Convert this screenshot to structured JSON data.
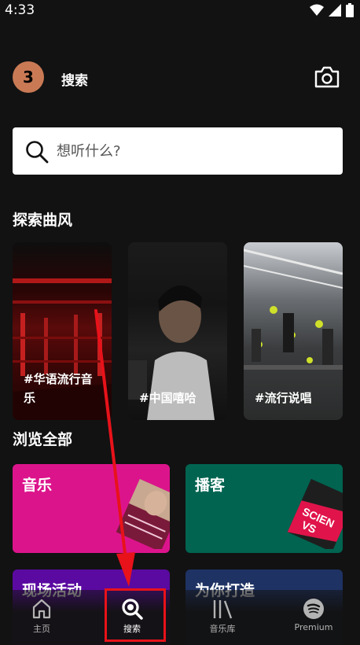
{
  "status_bar": {
    "time": "4:33"
  },
  "header": {
    "avatar_letter": "3",
    "title": "搜索"
  },
  "search": {
    "placeholder": "想听什么?"
  },
  "sections": {
    "explore_title": "探索曲风",
    "browse_title": "浏览全部"
  },
  "genre_cards": [
    {
      "label": "#华语流行音乐"
    },
    {
      "label": "#中国嘻哈"
    },
    {
      "label": "#流行说唱"
    }
  ],
  "browse_cards": [
    {
      "label": "音乐",
      "color": "#dc148c"
    },
    {
      "label": "播客",
      "color": "#006450"
    },
    {
      "label": "现场活动",
      "color": "#8400e7"
    },
    {
      "label": "为你打造",
      "color": "#1e3264"
    }
  ],
  "bottom_nav": [
    {
      "label": "主页",
      "icon": "home-icon"
    },
    {
      "label": "搜索",
      "icon": "search-icon"
    },
    {
      "label": "音乐库",
      "icon": "library-icon"
    },
    {
      "label": "Premium",
      "icon": "spotify-icon"
    }
  ],
  "annotation": {
    "color": "#e8121a"
  }
}
